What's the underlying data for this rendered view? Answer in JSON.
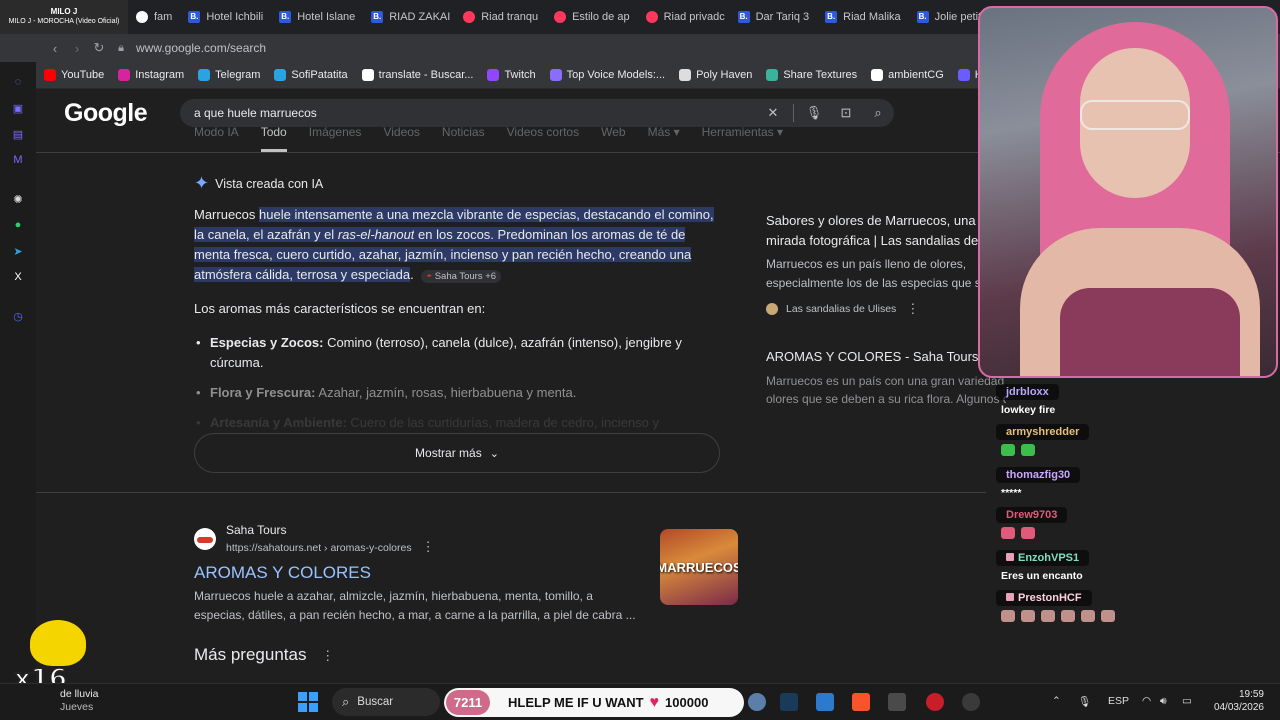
{
  "now_playing": {
    "title": "MILO J",
    "subtitle": "MILO J - MOROCHA (Video Oficial)"
  },
  "tabs": [
    {
      "label": "fam",
      "icon": "generic-tab-icon",
      "kind": "g"
    },
    {
      "label": "Hotel Ichbili",
      "icon": "booking-icon",
      "kind": "b"
    },
    {
      "label": "Hotel Islane",
      "icon": "booking-icon",
      "kind": "b"
    },
    {
      "label": "RIAD ZAKAI",
      "icon": "booking-icon",
      "kind": "b"
    },
    {
      "label": "Riad tranqu",
      "icon": "airbnb-icon",
      "kind": "a"
    },
    {
      "label": "Estilo de ap",
      "icon": "airbnb-icon",
      "kind": "a"
    },
    {
      "label": "Riad privadc",
      "icon": "airbnb-icon",
      "kind": "a"
    },
    {
      "label": "Dar Tariq 3",
      "icon": "booking-icon",
      "kind": "b"
    },
    {
      "label": "Riad Malika",
      "icon": "booking-icon",
      "kind": "b"
    },
    {
      "label": "Jolie petit R",
      "icon": "booking-icon",
      "kind": "b"
    }
  ],
  "address": {
    "url": "www.google.com/search"
  },
  "bookmarks": [
    {
      "label": "YouTube",
      "color": "#ff0000"
    },
    {
      "label": "Instagram",
      "color": "#d6249f"
    },
    {
      "label": "Telegram",
      "color": "#2aa3e0"
    },
    {
      "label": "SofiPatatita",
      "color": "#2aa3e0"
    },
    {
      "label": "translate - Buscar...",
      "color": "#ffffff"
    },
    {
      "label": "Twitch",
      "color": "#9146ff"
    },
    {
      "label": "Top Voice Models:...",
      "color": "#8a6cff"
    },
    {
      "label": "Poly Haven",
      "color": "#dddddd"
    },
    {
      "label": "Share Textures",
      "color": "#3ab39a"
    },
    {
      "label": "ambientCG",
      "color": "#ffffff"
    },
    {
      "label": "Ha",
      "color": "#6a5cff"
    }
  ],
  "google": {
    "logo": "Google",
    "query": "a que huele marruecos",
    "tabs": [
      "Modo IA",
      "Todo",
      "Imágenes",
      "Videos",
      "Noticias",
      "Videos cortos",
      "Web",
      "Más ▾",
      "Herramientas ▾"
    ]
  },
  "ai_overview": {
    "header": "Vista creada con IA",
    "p1_a": "Marruecos ",
    "p1_hl1": "huele intensamente a una mezcla vibrante de especias, destacando el comino, la canela, el azafrán y el ",
    "p1_hl_em": "ras-el-hanout",
    "p1_hl2": " en los zocos. Predominan los aromas de té de menta fresca, cuero curtido, azahar, jazmín, incienso y pan recién hecho, creando una atmósfera cálida, terrosa y especiada",
    "p1_end": ".",
    "source_chip": "Saha Tours +6",
    "intro": "Los aromas más característicos se encuentran en:",
    "bullets": [
      {
        "bold": "Especias y Zocos:",
        "text": " Comino (terroso), canela (dulce), azafrán (intenso), jengibre y cúrcuma."
      },
      {
        "bold": "Flora y Frescura:",
        "text": " Azahar, jazmín, rosas, hierbabuena y menta."
      },
      {
        "bold": "Artesanía y Ambiente:",
        "text": " Cuero de las curtidurías, madera de cedro, incienso y"
      }
    ],
    "show_more": "Mostrar más",
    "cards": [
      {
        "title1": "Sabores y olores de Marruecos, una",
        "title2": "mirada fotográfica | Las sandalias de",
        "snip1": "Marruecos es un país lleno de olores,",
        "snip2": "especialmente los de las especias que se",
        "source": "Las sandalias de Ulises"
      },
      {
        "title": "AROMAS Y COLORES - Saha Tours",
        "snip1": "Marruecos es un país con una gran variedad de",
        "snip2": "olores que se deben a su rica flora. Algunos d"
      }
    ]
  },
  "result": {
    "site": "Saha Tours",
    "url": "https://sahatours.net › aromas-y-colores",
    "title": "AROMAS Y COLORES",
    "snippet": "Marruecos huele a azahar, almizcle, jazmín, hierbabuena, menta, tomillo, a especias, dátiles, a pan recién hecho, a mar, a carne a la parrilla, a piel de cabra ...",
    "thumb_text": "MARRUECOS"
  },
  "more_questions": "Más preguntas",
  "chat": [
    {
      "user": "jdrbloxx",
      "color": "#b9a6ff",
      "text": "lowkey fire",
      "emotes": 0,
      "sub": false
    },
    {
      "user": "armyshredder",
      "color": "#e6c07a",
      "text": "",
      "emotes": 2,
      "emote_color": "#3bbf4a",
      "sub": false
    },
    {
      "user": "thomazfig30",
      "color": "#c8a6ff",
      "text": "*****",
      "emotes": 0,
      "sub": false
    },
    {
      "user": "Drew9703",
      "color": "#e05a7a",
      "text": "",
      "emotes": 2,
      "emote_color": "#e05a7a",
      "sub": false
    },
    {
      "user": "EnzohVPS1",
      "color": "#7fe0c0",
      "text": "Eres un encanto",
      "emotes": 0,
      "sub": true
    },
    {
      "user": "PrestonHCF",
      "color": "#ffd0e0",
      "text": "",
      "emotes": 6,
      "emote_color": "#c0908a",
      "sub": true
    }
  ],
  "mascot": {
    "label": "x16"
  },
  "taskbar": {
    "weather_title": "de lluvia",
    "weather_day": "Jueves",
    "search": "Buscar",
    "alert_count": "7211",
    "alert_text": "HLELP ME IF U WANT",
    "alert_value": "100000",
    "lang": "ESP",
    "time": "19:59",
    "date": "04/03/2026"
  }
}
